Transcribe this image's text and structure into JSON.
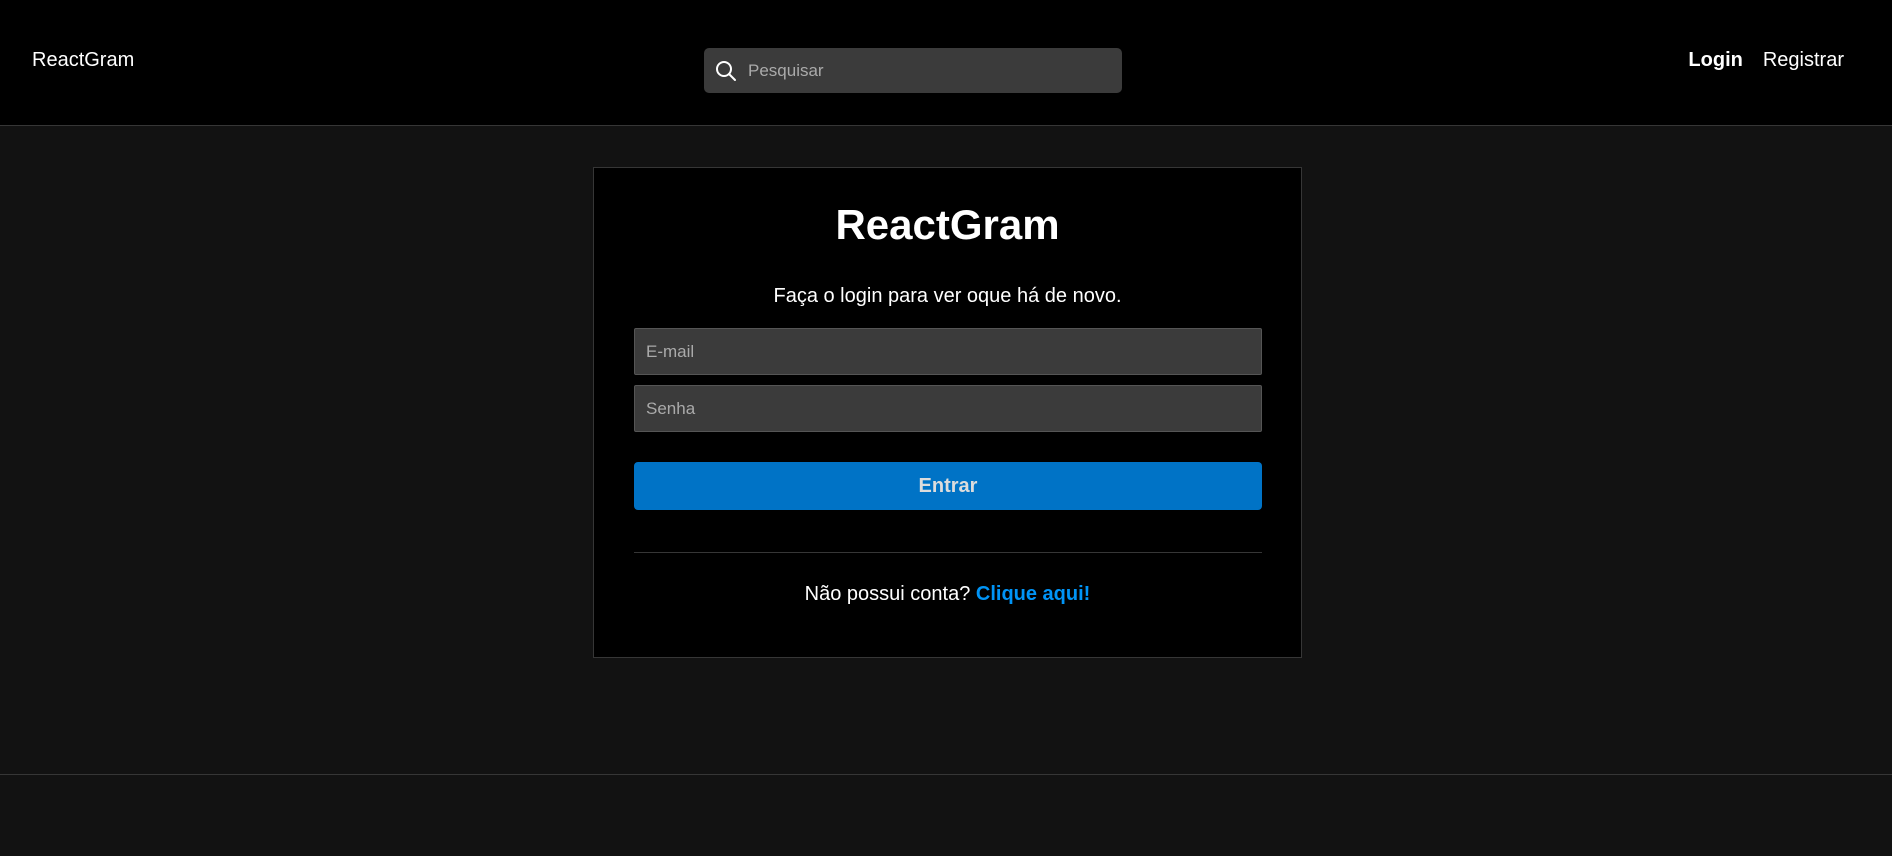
{
  "navbar": {
    "brand": "ReactGram",
    "search": {
      "placeholder": "Pesquisar",
      "icon": "search-icon"
    },
    "links": {
      "login": "Login",
      "register": "Registrar"
    }
  },
  "login_card": {
    "title": "ReactGram",
    "subtitle": "Faça o login para ver oque há de novo.",
    "email": {
      "placeholder": "E-mail",
      "value": ""
    },
    "password": {
      "placeholder": "Senha",
      "value": ""
    },
    "submit_label": "Entrar",
    "register_prompt": "Não possui conta?",
    "register_link": "Clique aqui!"
  },
  "colors": {
    "page_background": "#121212",
    "navbar_background": "#000000",
    "card_background": "#000000",
    "input_background": "#3b3b3b",
    "button_background": "#0073c6",
    "link_accent": "#0094f6",
    "border": "#363636"
  }
}
